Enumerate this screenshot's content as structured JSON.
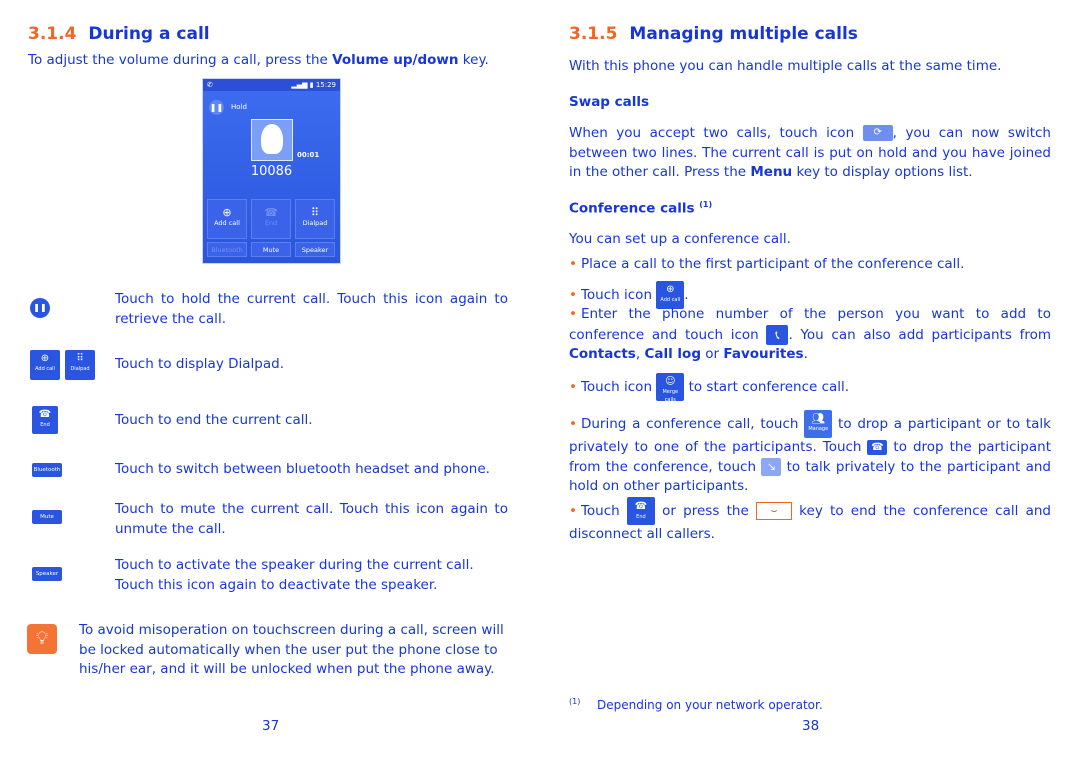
{
  "left_page": {
    "section_number": "3.1.4",
    "section_title": "During a call",
    "intro_pre": "To adjust the volume during a call, press the ",
    "intro_bold": "Volume up/down",
    "intro_post": " key.",
    "phone_screen": {
      "status_time": "15:29",
      "hold_label": "Hold",
      "call_timer": "00:01",
      "number": "10086",
      "buttons": {
        "add_call": "Add call",
        "end": "End",
        "dialpad": "Dialpad",
        "bluetooth": "Bluetooth",
        "mute": "Mute",
        "speaker": "Speaker"
      }
    },
    "icon_labels": {
      "add_call": "Add call",
      "dialpad": "Dialpad",
      "end": "End",
      "bluetooth": "Bluetooth",
      "mute": "Mute",
      "speaker": "Speaker"
    },
    "descriptions": {
      "hold": "Touch to hold the current call. Touch this icon again to retrieve the call.",
      "dialpad": "Touch to display Dialpad.",
      "end": "Touch to end the current call.",
      "bluetooth": "Touch to switch between bluetooth headset and phone.",
      "mute": "Touch to mute the current call. Touch this icon again to unmute the call.",
      "speaker": "Touch to activate the speaker during the current call. Touch this icon again to deactivate the speaker."
    },
    "tip": "To avoid misoperation on touchscreen during a call, screen will be locked automatically when the user put the phone close to his/her ear, and it will be unlocked when put the phone away.",
    "page_number": "37"
  },
  "right_page": {
    "section_number": "3.1.5",
    "section_title": "Managing multiple calls",
    "intro": "With this phone you can handle multiple calls at the same time.",
    "swap": {
      "heading": "Swap calls",
      "text_pre": "When you accept two calls, touch  icon ",
      "text_post": ", you can now switch between two lines. The current call is put on hold and you have joined in the other call.  Press the ",
      "menu": "Menu",
      "text_end": " key to display options list."
    },
    "conference": {
      "heading": "Conference calls",
      "footnote_ref": "(1)",
      "intro": "You can set up a conference call.",
      "b1": "Place a call to the first participant of the conference call.",
      "b2_pre": "Touch icon ",
      "b2_post": ".",
      "b3_pre": "Enter the phone number of the person you want to add to conference and touch icon ",
      "b3_mid": ". You can also add participants from ",
      "b3_contacts": "Contacts",
      "b3_sep": ", ",
      "b3_calllog": "Call log",
      "b3_or": " or ",
      "b3_fav": "Favourites",
      "b3_end": ".",
      "b4_pre": "Touch icon ",
      "b4_post": " to start conference call.",
      "b5_a": "During a conference call, touch ",
      "b5_b": " to drop a participant or to talk privately to one of the participants. Touch ",
      "b5_c": " to drop the participant from the conference, touch ",
      "b5_d": " to talk privately to the participant and hold on other participants.",
      "b6_a": "Touch ",
      "b6_b": " or press the ",
      "b6_c": " key to end the conference call and disconnect all callers.",
      "icon_labels": {
        "add_call": "Add call",
        "merge": "Merge calls",
        "manage": "Manage",
        "end": "End"
      }
    },
    "footnote_mark": "(1)",
    "footnote": "Depending on your network operator.",
    "page_number": "38"
  }
}
